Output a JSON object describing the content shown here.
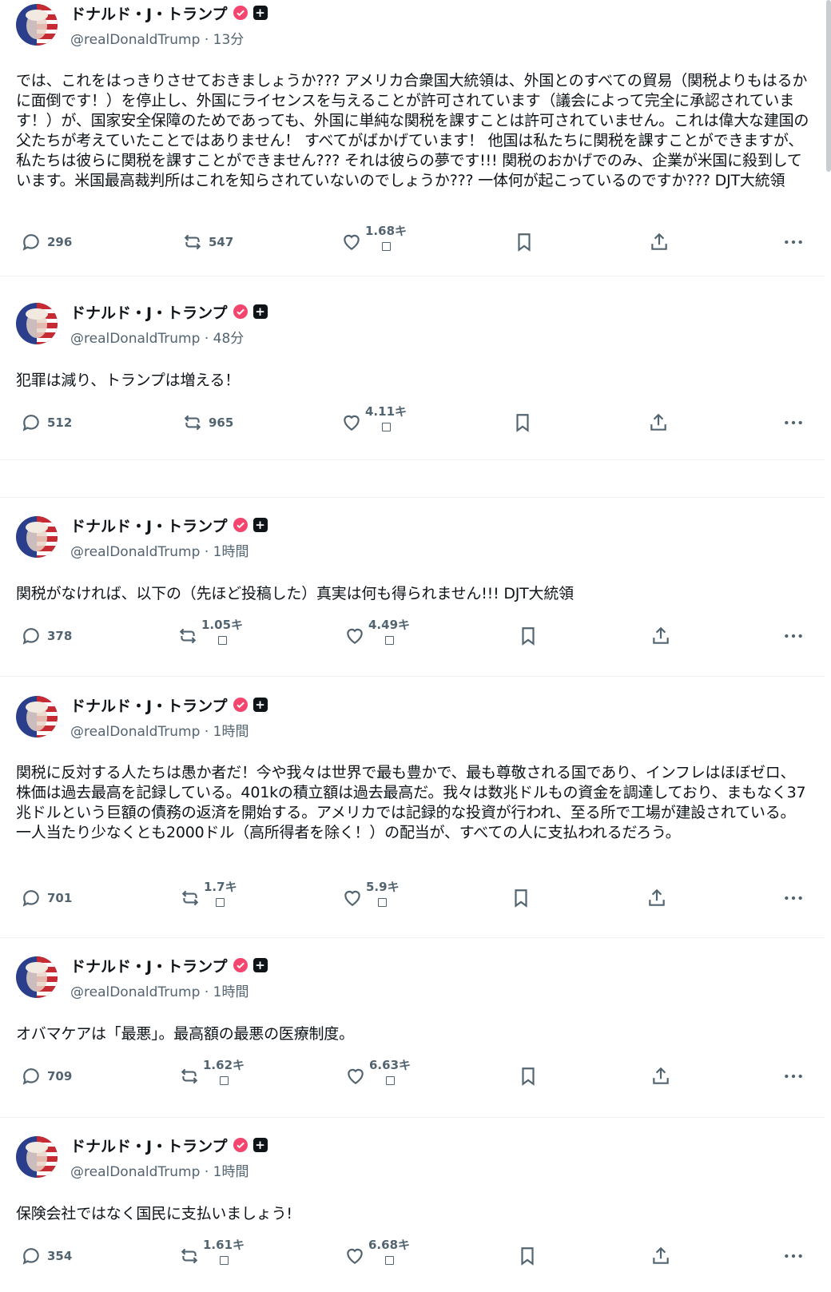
{
  "author": {
    "name": "ドナルド・J・トランプ",
    "handle": "@realDonaldTrump"
  },
  "posts": [
    {
      "time": "13分",
      "text": "では、これをはっきりさせておきましょうか??? アメリカ合衆国大統領は、外国とのすべての貿易（関税よりもはるかに面倒です！）を停止し、外国にライセンスを与えることが許可されています（議会によって完全に承認されています！）が、国家安全保障のためであっても、外国に単純な関税を課すことは許可されていません。これは偉大な建国の父たちが考えていたことではありません！ すべてがばかげています！ 他国は私たちに関税を課すことができますが、私たちは彼らに関税を課すことができません??? それは彼らの夢です!!! 関税のおかげでのみ、企業が米国に殺到しています。米国最高裁判所はこれを知らされていないのでしょうか??? 一体何が起こっているのですか??? DJT大統領",
      "replies": "296",
      "reposts": "547",
      "likes": "1.68キ"
    },
    {
      "time": "48分",
      "text": "犯罪は減り、トランプは増える！",
      "replies": "512",
      "reposts": "965",
      "likes": "4.11キ"
    },
    {
      "time": "1時間",
      "text": "関税がなければ、以下の（先ほど投稿した）真実は何も得られません!!! DJT大統領",
      "replies": "378",
      "reposts": "1.05キ",
      "likes": "4.49キ"
    },
    {
      "time": "1時間",
      "text": "関税に反対する人たちは愚か者だ！今や我々は世界で最も豊かで、最も尊敬される国であり、インフレはほぼゼロ、株価は過去最高を記録している。401kの積立額は過去最高だ。我々は数兆ドルもの資金を調達しており、まもなく37兆ドルという巨額の債務の返済を開始する。アメリカでは記録的な投資が行われ、至る所で工場が建設されている。一人当たり少なくとも2000ドル（高所得者を除く！）の配当が、すべての人に支払われるだろう。",
      "replies": "701",
      "reposts": "1.7キ",
      "likes": "5.9キ"
    },
    {
      "time": "1時間",
      "text": "オバマケアは「最悪」。最高額の最悪の医療制度。",
      "replies": "709",
      "reposts": "1.62キ",
      "likes": "6.63キ"
    },
    {
      "time": "1時間",
      "text": "保険会社ではなく国民に支払いましょう!",
      "replies": "354",
      "reposts": "1.61キ",
      "likes": "6.68キ"
    }
  ],
  "icons": {
    "reply": "reply-icon",
    "repost": "repost-icon",
    "like": "heart-icon",
    "bookmark": "bookmark-icon",
    "share": "share-icon",
    "more": "more-icon",
    "verified": "verified-badge-icon",
    "plus": "plus-badge-icon"
  },
  "colors": {
    "verified": "#f4456f",
    "text": "#0f1419",
    "muted": "#536471"
  }
}
